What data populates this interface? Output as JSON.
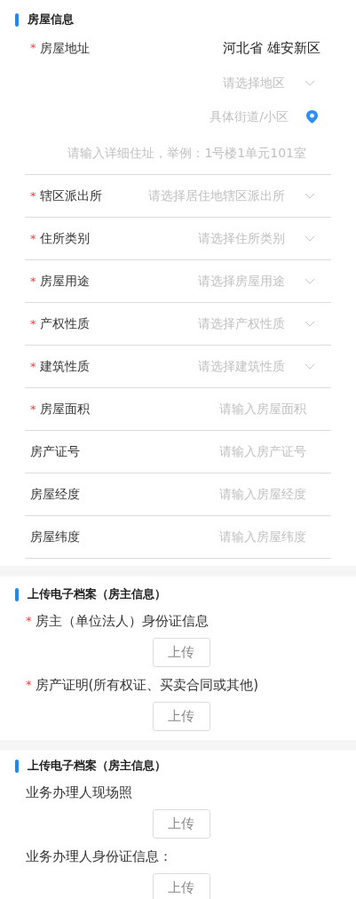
{
  "sections": [
    {
      "kind": "form",
      "title": "房屋信息",
      "address": {
        "mark": "*",
        "label": "房屋地址",
        "value": "河北省 雄安新区",
        "region_placeholder": "请选择地区",
        "street_placeholder": "具体街道/小区",
        "detail_placeholder": "请输入详细住址，举例：1号楼1单元101室"
      },
      "fields": [
        {
          "mark": "*",
          "label": "辖区派出所",
          "kind": "select",
          "placeholder": "请选择居住地辖区派出所"
        },
        {
          "mark": "*",
          "label": "住所类别",
          "kind": "select",
          "placeholder": "请选择住所类别"
        },
        {
          "mark": "*",
          "label": "房屋用途",
          "kind": "select",
          "placeholder": "请选择房屋用途"
        },
        {
          "mark": "*",
          "label": "产权性质",
          "kind": "select",
          "placeholder": "请选择产权性质"
        },
        {
          "mark": "*",
          "label": "建筑性质",
          "kind": "select",
          "placeholder": "请选择建筑性质"
        },
        {
          "mark": "*",
          "label": "房屋面积",
          "kind": "input",
          "placeholder": "请输入房屋面积"
        },
        {
          "label": "房产证号",
          "kind": "input",
          "placeholder": "请输入房产证号"
        },
        {
          "label": "房屋经度",
          "kind": "input",
          "placeholder": "请输入房屋经度"
        },
        {
          "label": "房屋纬度",
          "kind": "input",
          "placeholder": "请输入房屋纬度"
        }
      ]
    },
    {
      "kind": "uploads",
      "title": "上传电子档案（房主信息）",
      "items": [
        {
          "mark": "*",
          "label": "房主（单位法人）身份证信息",
          "button": "上传"
        },
        {
          "mark": "*",
          "label": "房产证明(所有权证、买卖合同或其他)",
          "button": "上传"
        }
      ]
    },
    {
      "kind": "uploads",
      "title": "上传电子档案（房主信息）",
      "items": [
        {
          "label": "业务办理人现场照",
          "button": "上传"
        },
        {
          "label": "业务办理人身份证信息：",
          "button": "上传"
        }
      ]
    }
  ]
}
